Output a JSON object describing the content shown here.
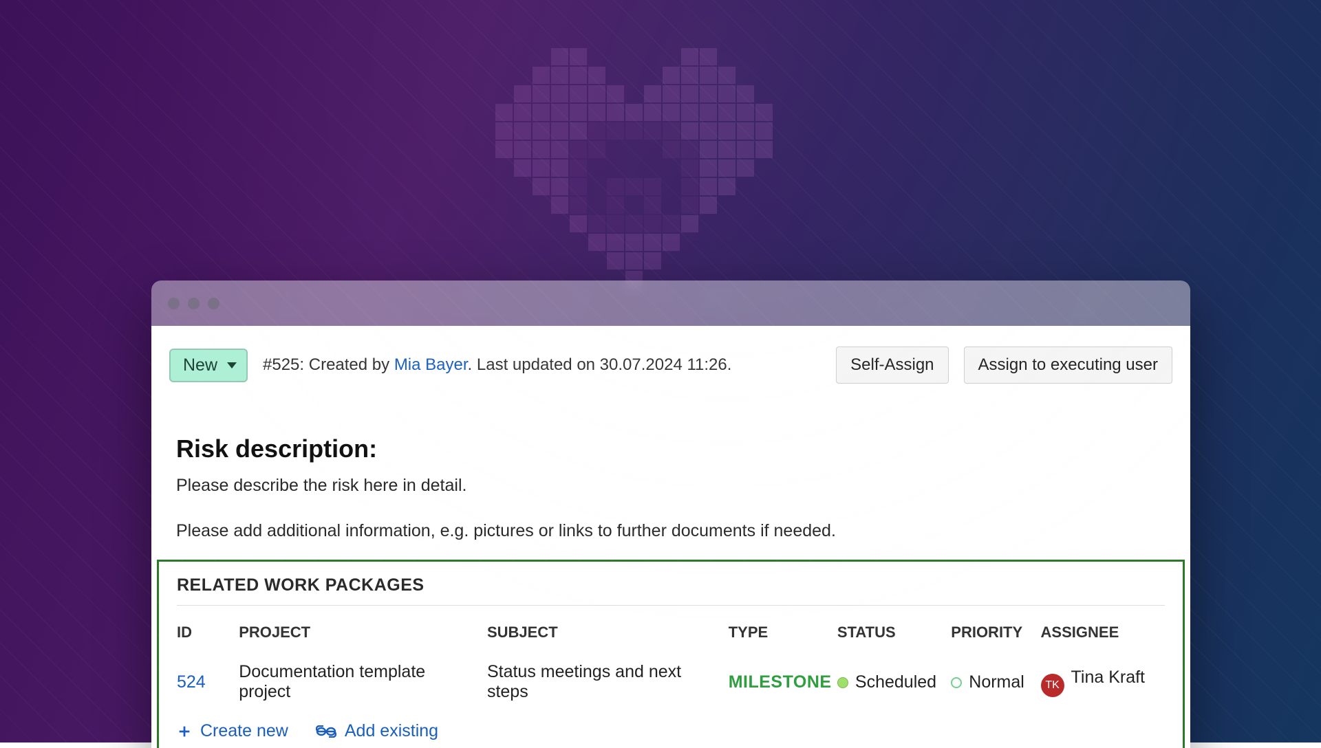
{
  "header": {
    "status_label": "New",
    "item_ref": "#525",
    "created_prefix": ": Created by ",
    "created_by": "Mia Bayer",
    "updated_text": ". Last updated on 30.07.2024 11:26.",
    "self_assign_label": "Self-Assign",
    "assign_exec_label": "Assign to executing user"
  },
  "description": {
    "heading": "Risk description:",
    "line1": "Please describe the risk here in detail.",
    "line2": "Please add additional information, e.g. pictures or links to further documents if needed."
  },
  "related": {
    "title": "RELATED WORK PACKAGES",
    "columns": {
      "id": "ID",
      "project": "PROJECT",
      "subject": "SUBJECT",
      "type": "TYPE",
      "status": "STATUS",
      "priority": "PRIORITY",
      "assignee": "ASSIGNEE"
    },
    "row": {
      "id": "524",
      "project": "Documentation template project",
      "subject": "Status meetings and next steps",
      "type": "MILESTONE",
      "status": "Scheduled",
      "priority": "Normal",
      "assignee_initials": "TK",
      "assignee_name": "Tina Kraft"
    },
    "create_new_label": "Create new",
    "add_existing_label": "Add existing"
  }
}
